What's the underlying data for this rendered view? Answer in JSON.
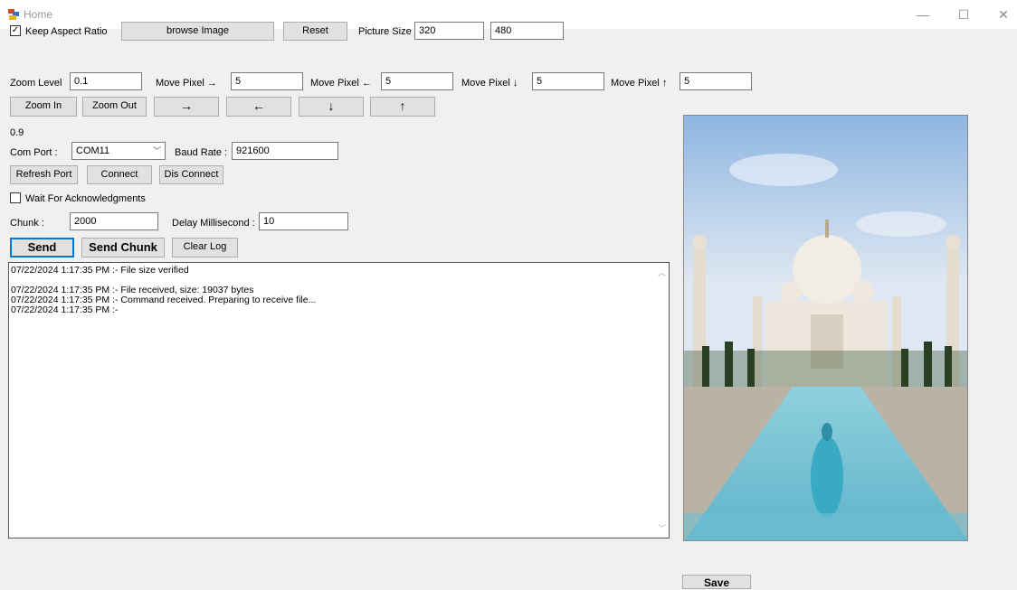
{
  "window": {
    "title": "Home",
    "minimize": "—",
    "maximize": "☐",
    "close": "✕"
  },
  "row1": {
    "keep_aspect_label": "Keep Aspect Ratio",
    "keep_aspect_checked": "✓",
    "browse_label": "browse Image",
    "reset_label": "Reset",
    "picture_size_label": "Picture Size",
    "width_value": "320",
    "height_value": "480"
  },
  "row2": {
    "zoom_level_label": "Zoom Level",
    "zoom_level_value": "0.1",
    "move_right_label": "Move Pixel →",
    "move_right_value": "5",
    "move_left_label": "Move Pixel ←",
    "move_left_value": "5",
    "move_down_label": "Move Pixel ↓",
    "move_down_value": "5",
    "move_up_label": "Move Pixel ↑",
    "move_up_value": "5"
  },
  "row3": {
    "zoom_in_label": "Zoom In",
    "zoom_out_label": "Zoom Out",
    "right_arrow": "→",
    "left_arrow": "←",
    "down_arrow": "↓",
    "up_arrow": "↑"
  },
  "zoom_display": "0.9",
  "serial": {
    "com_port_label": "Com Port :",
    "com_port_value": "COM11",
    "baud_rate_label": "Baud Rate :",
    "baud_rate_value": "921600",
    "refresh_label": "Refresh Port",
    "connect_label": "Connect",
    "disconnect_label": "Dis Connect",
    "wait_ack_label": "Wait For Acknowledgments"
  },
  "chunk": {
    "chunk_label": "Chunk :",
    "chunk_value": "2000",
    "delay_label": "Delay Millisecond :",
    "delay_value": "10"
  },
  "actions": {
    "send_label": "Send",
    "send_chunk_label": "Send Chunk",
    "clear_log_label": "Clear Log"
  },
  "log": {
    "lines": [
      "07/22/2024 1:17:35 PM :- File size verified",
      "",
      "07/22/2024 1:17:35 PM :- File received, size: 19037 bytes",
      "07/22/2024 1:17:35 PM :- Command received. Preparing to receive file...",
      "07/22/2024 1:17:35 PM :-"
    ]
  },
  "save_label": "Save"
}
